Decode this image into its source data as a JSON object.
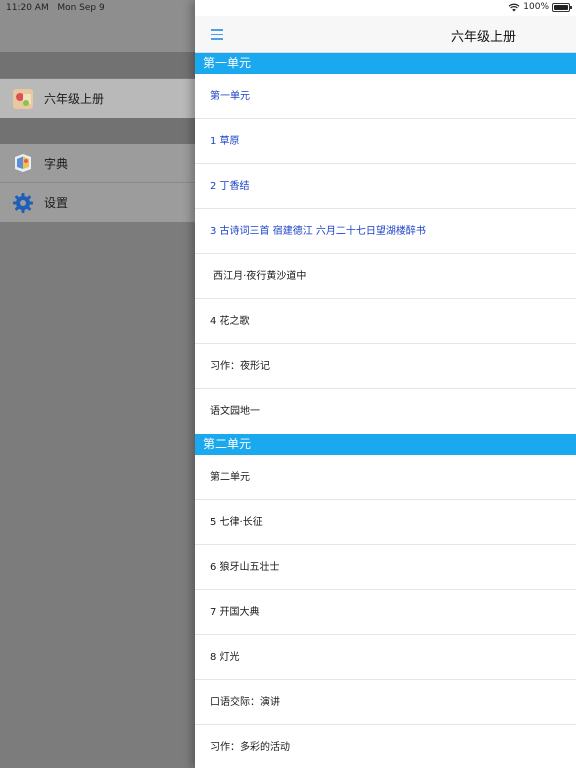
{
  "status": {
    "time": "11:20 AM",
    "date": "Mon Sep 9",
    "battery": "100%"
  },
  "sidebar": {
    "items": [
      {
        "label": "六年级上册",
        "icon": "book-cover-icon"
      },
      {
        "label": "字典",
        "icon": "dictionary-icon"
      },
      {
        "label": "设置",
        "icon": "gear-icon"
      }
    ]
  },
  "nav": {
    "title": "六年级上册"
  },
  "sections": [
    {
      "title": "第一单元",
      "rows": [
        {
          "label": "第一单元",
          "color": "blue"
        },
        {
          "label": "1 草原",
          "color": "blue"
        },
        {
          "label": "2 丁香结",
          "color": "blue"
        },
        {
          "label": "3 古诗词三首  宿建德江  六月二十七日望湖楼醉书",
          "color": "blue"
        },
        {
          "label": " 西江月·夜行黄沙道中",
          "color": "black"
        },
        {
          "label": "4 花之歌",
          "color": "black"
        },
        {
          "label": "习作：夜形记",
          "color": "black"
        },
        {
          "label": "语文园地一",
          "color": "black"
        }
      ]
    },
    {
      "title": "第二单元",
      "rows": [
        {
          "label": "第二单元",
          "color": "black"
        },
        {
          "label": "5 七律·长征",
          "color": "black"
        },
        {
          "label": "6 狼牙山五壮士",
          "color": "black"
        },
        {
          "label": "7 开国大典",
          "color": "black"
        },
        {
          "label": "8 灯光",
          "color": "black"
        },
        {
          "label": "口语交际：演讲",
          "color": "black"
        },
        {
          "label": "习作：多彩的活动",
          "color": "black"
        }
      ]
    }
  ]
}
